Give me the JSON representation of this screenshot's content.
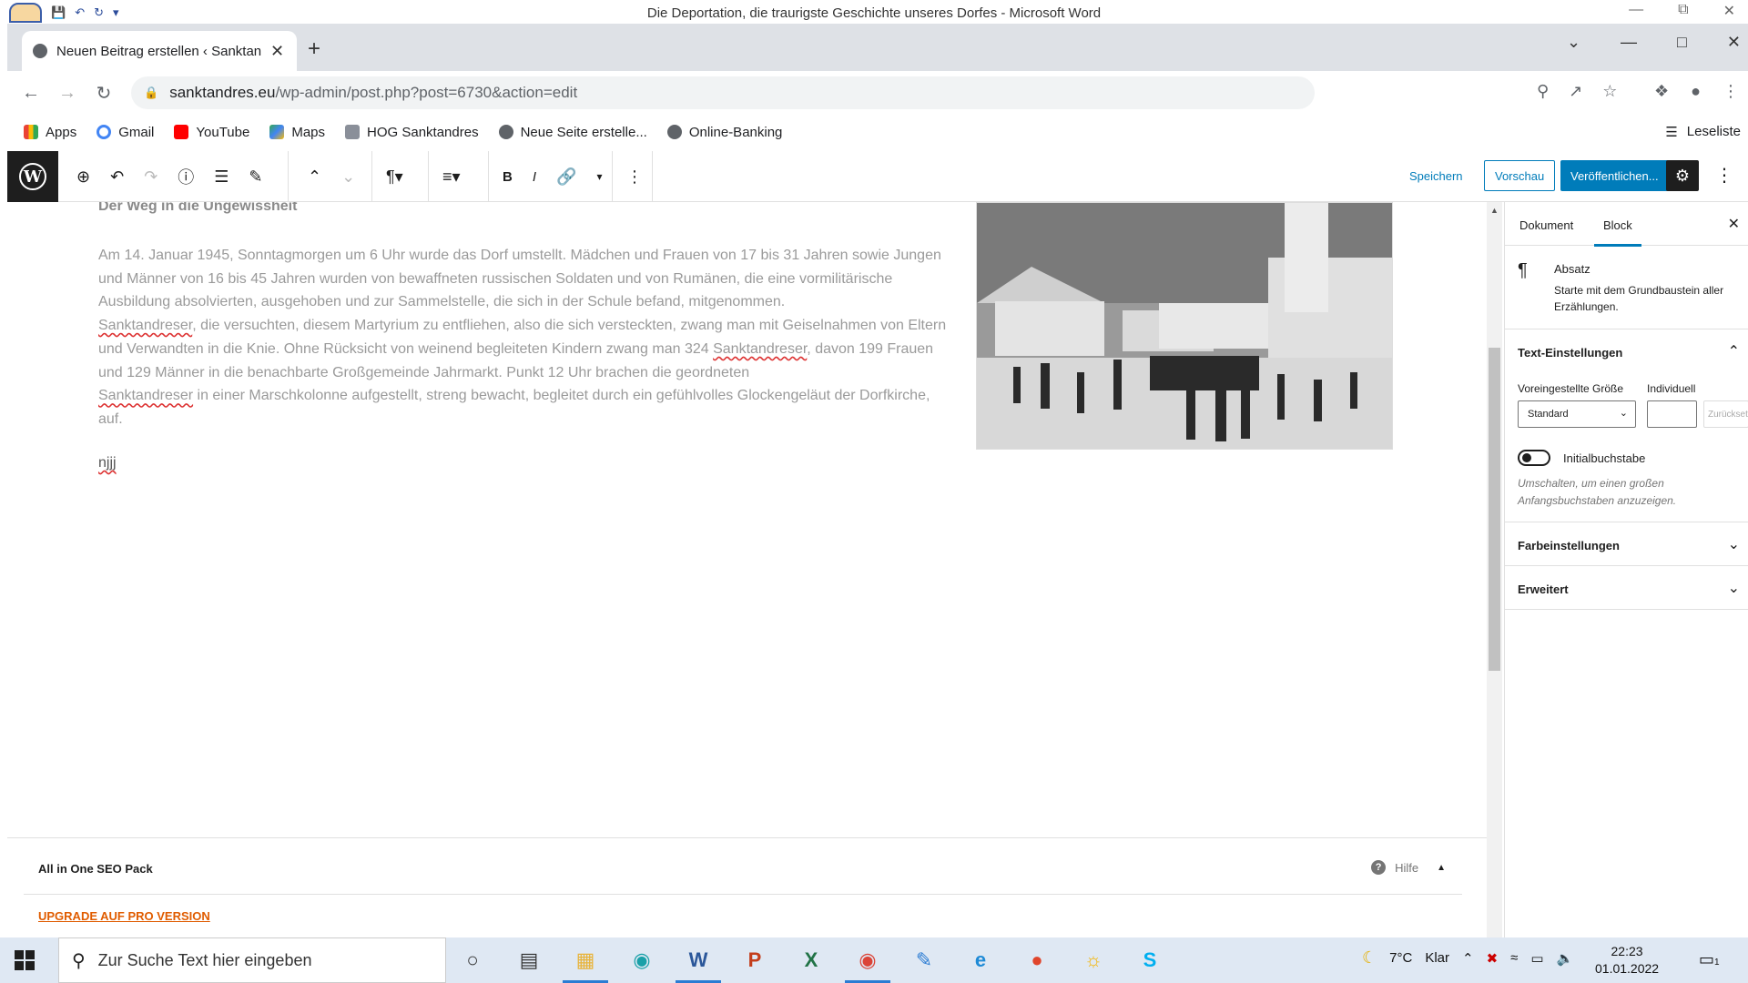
{
  "word": {
    "title": "Die Deportation, die traurigste Geschichte unseres Dorfes - Microsoft Word"
  },
  "browser": {
    "tab_title": "Neuen Beitrag erstellen ‹ Sanktandres",
    "url_domain": "sanktandres.eu",
    "url_path": "/wp-admin/post.php?post=6730&action=edit",
    "bookmarks": [
      "Apps",
      "Gmail",
      "YouTube",
      "Maps",
      "HOG Sanktandres",
      "Neue Seite erstelle...",
      "Online-Banking"
    ],
    "reading_list": "Leseliste"
  },
  "editor_header": {
    "save": "Speichern",
    "preview": "Vorschau",
    "publish": "Veröffentlichen..."
  },
  "content": {
    "heading": "Der Weg in die Ungewissheit",
    "para_1": "Am 14. Januar 1945, Sonntagmorgen um 6 Uhr wurde das Dorf umstellt. Mädchen und Frauen von 17 bis 31 Jahren sowie Jungen und Männer von 16 bis 45 Jahren wurden von bewaffneten russischen Soldaten und von Rumänen, die eine vormilitärische Ausbildung absolvierten, ausgehoben und zur Sammelstelle, die sich in der Schule befand, mitgenommen.",
    "word_1": "Sanktandreser",
    "para_2": ", die versuchten, diesem Martyrium zu entfliehen, also die sich versteckten, zwang man mit Geiselnahmen von Eltern und Verwandten in die Knie. Ohne Rücksicht von weinend begleiteten Kindern zwang man 324 ",
    "word_2": "Sanktandreser",
    "para_3": ", davon 199 Frauen und 129 Männer in die benachbarte Großgemeinde Jahrmarkt. Punkt 12 Uhr brachen die geordneten ",
    "word_3": "Sanktandreser",
    "para_4": " in einer Marschkolonne aufgestellt, streng bewacht, begleitet durch ein gefühlvolles Glockengeläut der Dorfkirche, auf.",
    "short_para": "njjj"
  },
  "seo": {
    "title": "All in One SEO Pack",
    "help": "Hilfe",
    "upgrade": "UPGRADE AUF PRO VERSION"
  },
  "sidebar": {
    "tab_document": "Dokument",
    "tab_block": "Block",
    "block_name": "Absatz",
    "block_desc": "Starte mit dem Grundbaustein aller Erzählungen.",
    "text_settings": "Text-Einstellungen",
    "preset_size_label": "Voreingestellte Größe",
    "custom_label": "Individuell",
    "preset_value": "Standard",
    "reset": "Zurücksetzen",
    "dropcap_label": "Initialbuchstabe",
    "dropcap_help": "Umschalten, um einen großen Anfangsbuchstaben anzuzeigen.",
    "color_settings": "Farbeinstellungen",
    "advanced": "Erweitert"
  },
  "taskbar": {
    "search_placeholder": "Zur Suche Text hier eingeben",
    "weather_temp": "7°C",
    "weather_text": "Klar",
    "time": "22:23",
    "date": "01.01.2022",
    "notif_count": "1"
  }
}
